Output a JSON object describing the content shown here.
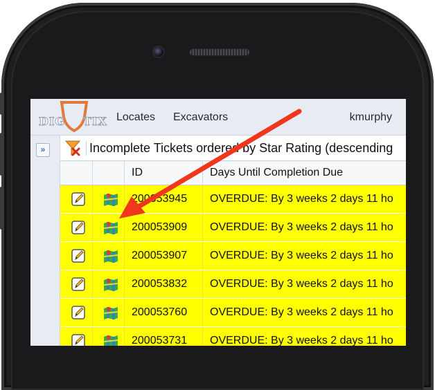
{
  "app": {
    "logo_left": "DIG",
    "logo_right": "TIX",
    "nav": [
      "Locates",
      "Excavators"
    ],
    "user": "kmurphy"
  },
  "list": {
    "title": "Incomplete Tickets ordered by Star Rating (descending",
    "columns": [
      "",
      "",
      "ID",
      "Days Until Completion Due"
    ],
    "rows": [
      {
        "id": "200053945",
        "due": "OVERDUE: By 3 weeks 2 days 11 ho",
        "edit_icon": "note-pencil-icon",
        "map_icon": "map-icon"
      },
      {
        "id": "200053909",
        "due": "OVERDUE: By 3 weeks 2 days 11 ho",
        "edit_icon": "note-pencil-icon",
        "map_icon": "map-icon"
      },
      {
        "id": "200053907",
        "due": "OVERDUE: By 3 weeks 2 days 11 ho",
        "edit_icon": "note-pencil-icon",
        "map_icon": "map-icon"
      },
      {
        "id": "200053832",
        "due": "OVERDUE: By 3 weeks 2 days 11 ho",
        "edit_icon": "note-pencil-icon",
        "map_icon": "map-icon"
      },
      {
        "id": "200053760",
        "due": "OVERDUE: By 3 weeks 2 days 11 ho",
        "edit_icon": "note-pencil-icon",
        "map_icon": "map-icon"
      },
      {
        "id": "200053731",
        "due": "OVERDUE: By 3 weeks 2 days 11 ho",
        "edit_icon": "note-pencil-icon",
        "map_icon": "map-icon"
      }
    ]
  },
  "colors": {
    "row_highlight": "#ffff00",
    "annotation_arrow": "#f0371e",
    "logo_shield": "#e07a3a"
  }
}
